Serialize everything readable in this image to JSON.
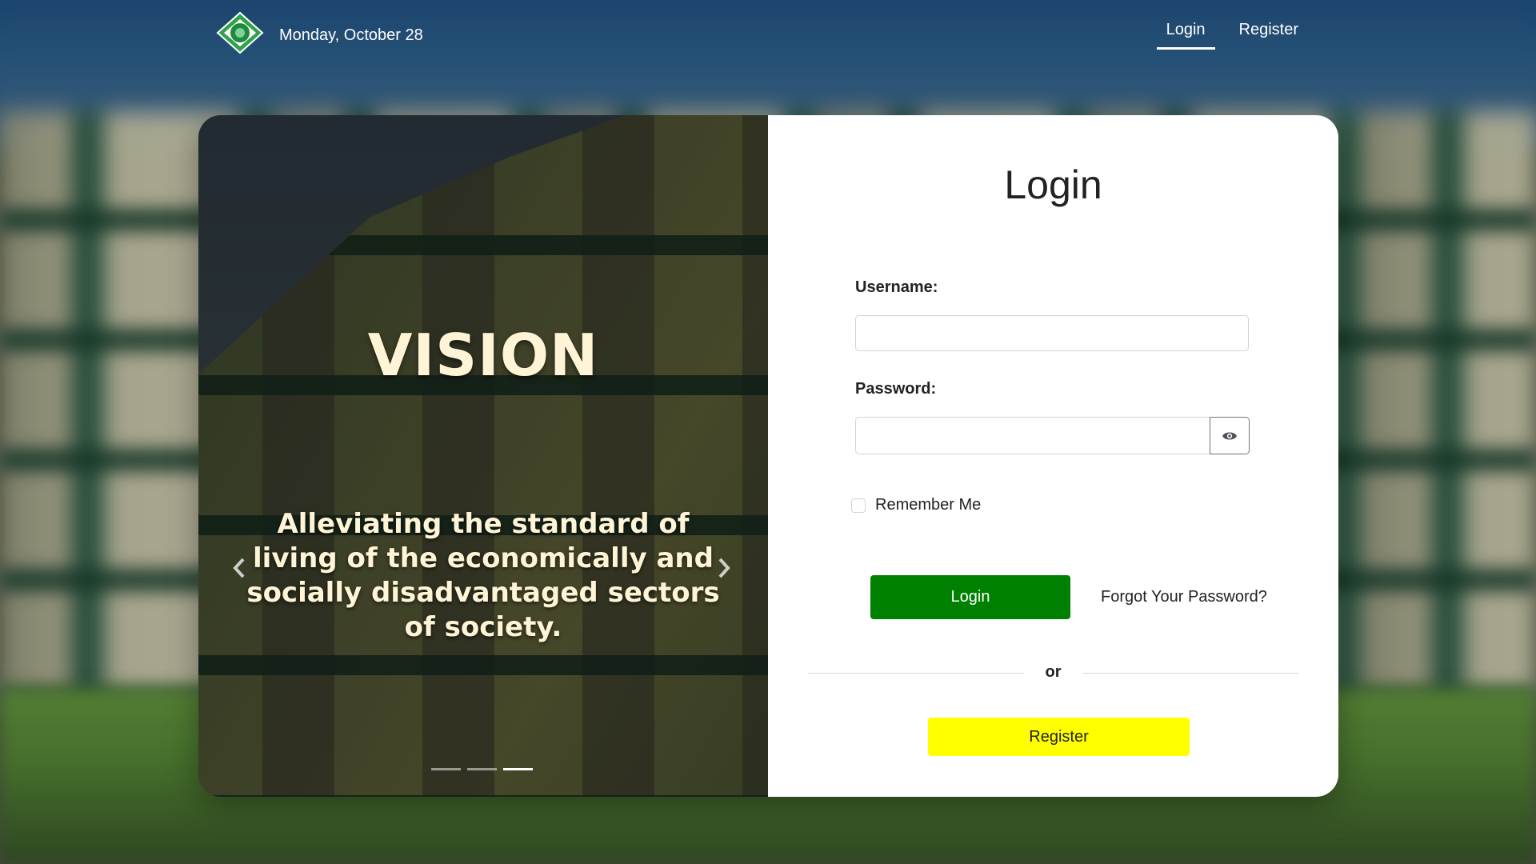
{
  "header": {
    "date": "Monday, October 28",
    "logo_icon": "school-emblem-icon",
    "nav": {
      "login_label": "Login",
      "register_label": "Register"
    }
  },
  "carousel": {
    "title": "VISION",
    "text": "Alleviating the standard of living of the economically and socially disadvantaged sectors of society.",
    "prev_icon": "chevron-left-icon",
    "next_icon": "chevron-right-icon",
    "slide_count": 3,
    "active_slide": 3
  },
  "login_form": {
    "title": "Login",
    "username_label": "Username:",
    "username_value": "",
    "password_label": "Password:",
    "password_value": "",
    "show_password_icon": "eye-icon",
    "remember_label": "Remember Me",
    "remember_checked": false,
    "login_button": "Login",
    "forgot_link": "Forgot Your Password?",
    "divider_text": "or",
    "register_button": "Register"
  },
  "colors": {
    "login_button": "#008000",
    "register_button": "#ffff00",
    "slide_text": "#fff5d6"
  }
}
